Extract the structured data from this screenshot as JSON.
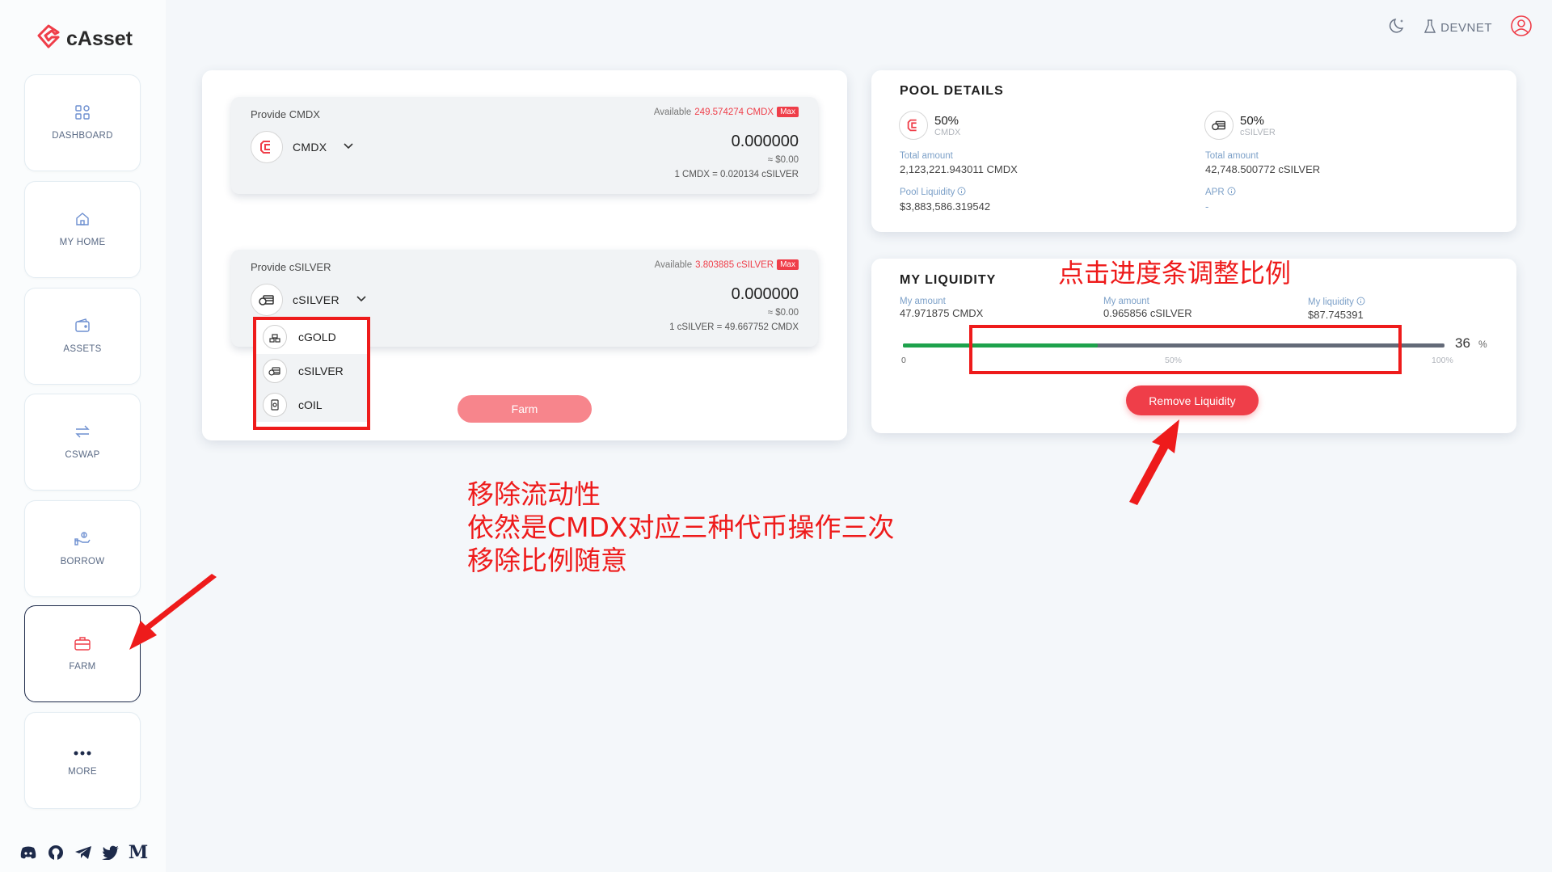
{
  "app": {
    "logo_text": "cAsset"
  },
  "sidebar": {
    "items": [
      {
        "label": "DASHBOARD",
        "icon": "dashboard-icon"
      },
      {
        "label": "MY HOME",
        "icon": "home-icon"
      },
      {
        "label": "ASSETS",
        "icon": "wallet-icon"
      },
      {
        "label": "CSWAP",
        "icon": "swap-icon"
      },
      {
        "label": "BORROW",
        "icon": "borrow-icon"
      },
      {
        "label": "FARM",
        "icon": "briefcase-icon",
        "active": true
      },
      {
        "label": "MORE",
        "icon": "more-icon"
      }
    ],
    "social": [
      "discord-icon",
      "github-icon",
      "telegram-icon",
      "twitter-icon",
      "medium-icon"
    ]
  },
  "header": {
    "network": "DEVNET"
  },
  "provide_a": {
    "label": "Provide CMDX",
    "available_prefix": "Available",
    "available_value": "249.574274 CMDX",
    "max": "Max",
    "token": "CMDX",
    "amount": "0.000000",
    "usd": "≈ $0.00",
    "rate": "1 CMDX = 0.020134 cSILVER"
  },
  "provide_b": {
    "label": "Provide cSILVER",
    "available_prefix": "Available",
    "available_value": "3.803885 cSILVER",
    "max": "Max",
    "token": "cSILVER",
    "amount": "0.000000",
    "usd": "≈ $0.00",
    "rate": "1 cSILVER = 49.667752 CMDX"
  },
  "dropdown": {
    "options": [
      "cGOLD",
      "cSILVER",
      "cOIL"
    ]
  },
  "farm_button": "Farm",
  "pool": {
    "title": "POOL DETAILS",
    "a": {
      "pct": "50%",
      "token": "CMDX",
      "total_label": "Total amount",
      "total_value": "2,123,221.943011 CMDX",
      "extra_label": "Pool Liquidity",
      "extra_value": "$3,883,586.319542"
    },
    "b": {
      "pct": "50%",
      "token": "cSILVER",
      "total_label": "Total amount",
      "total_value": "42,748.500772 cSILVER",
      "extra_label": "APR",
      "extra_value": "-"
    }
  },
  "liquidity": {
    "title": "MY LIQUIDITY",
    "amount_a_label": "My amount",
    "amount_a_value": "47.971875 CMDX",
    "amount_b_label": "My amount",
    "amount_b_value": "0.965856 cSILVER",
    "liq_label": "My liquidity",
    "liq_value": "$87.745391",
    "slider_value": "36",
    "slider_fraction": 0.36,
    "pct_sign": "%",
    "tick_min": "0",
    "tick_mid": "50%",
    "tick_max": "100%",
    "remove_button": "Remove Liquidity"
  },
  "annotations": {
    "slider_note": "点击进度条调整比例",
    "main_note_1": "移除流动性",
    "main_note_2": "依然是CMDX对应三种代币操作三次",
    "main_note_3": "移除比例随意"
  },
  "colors": {
    "accent": "#ef3e49",
    "farm_disabled": "#f7858c",
    "slider_fill": "#1ea24c",
    "annotation": "#ee1b1b"
  }
}
